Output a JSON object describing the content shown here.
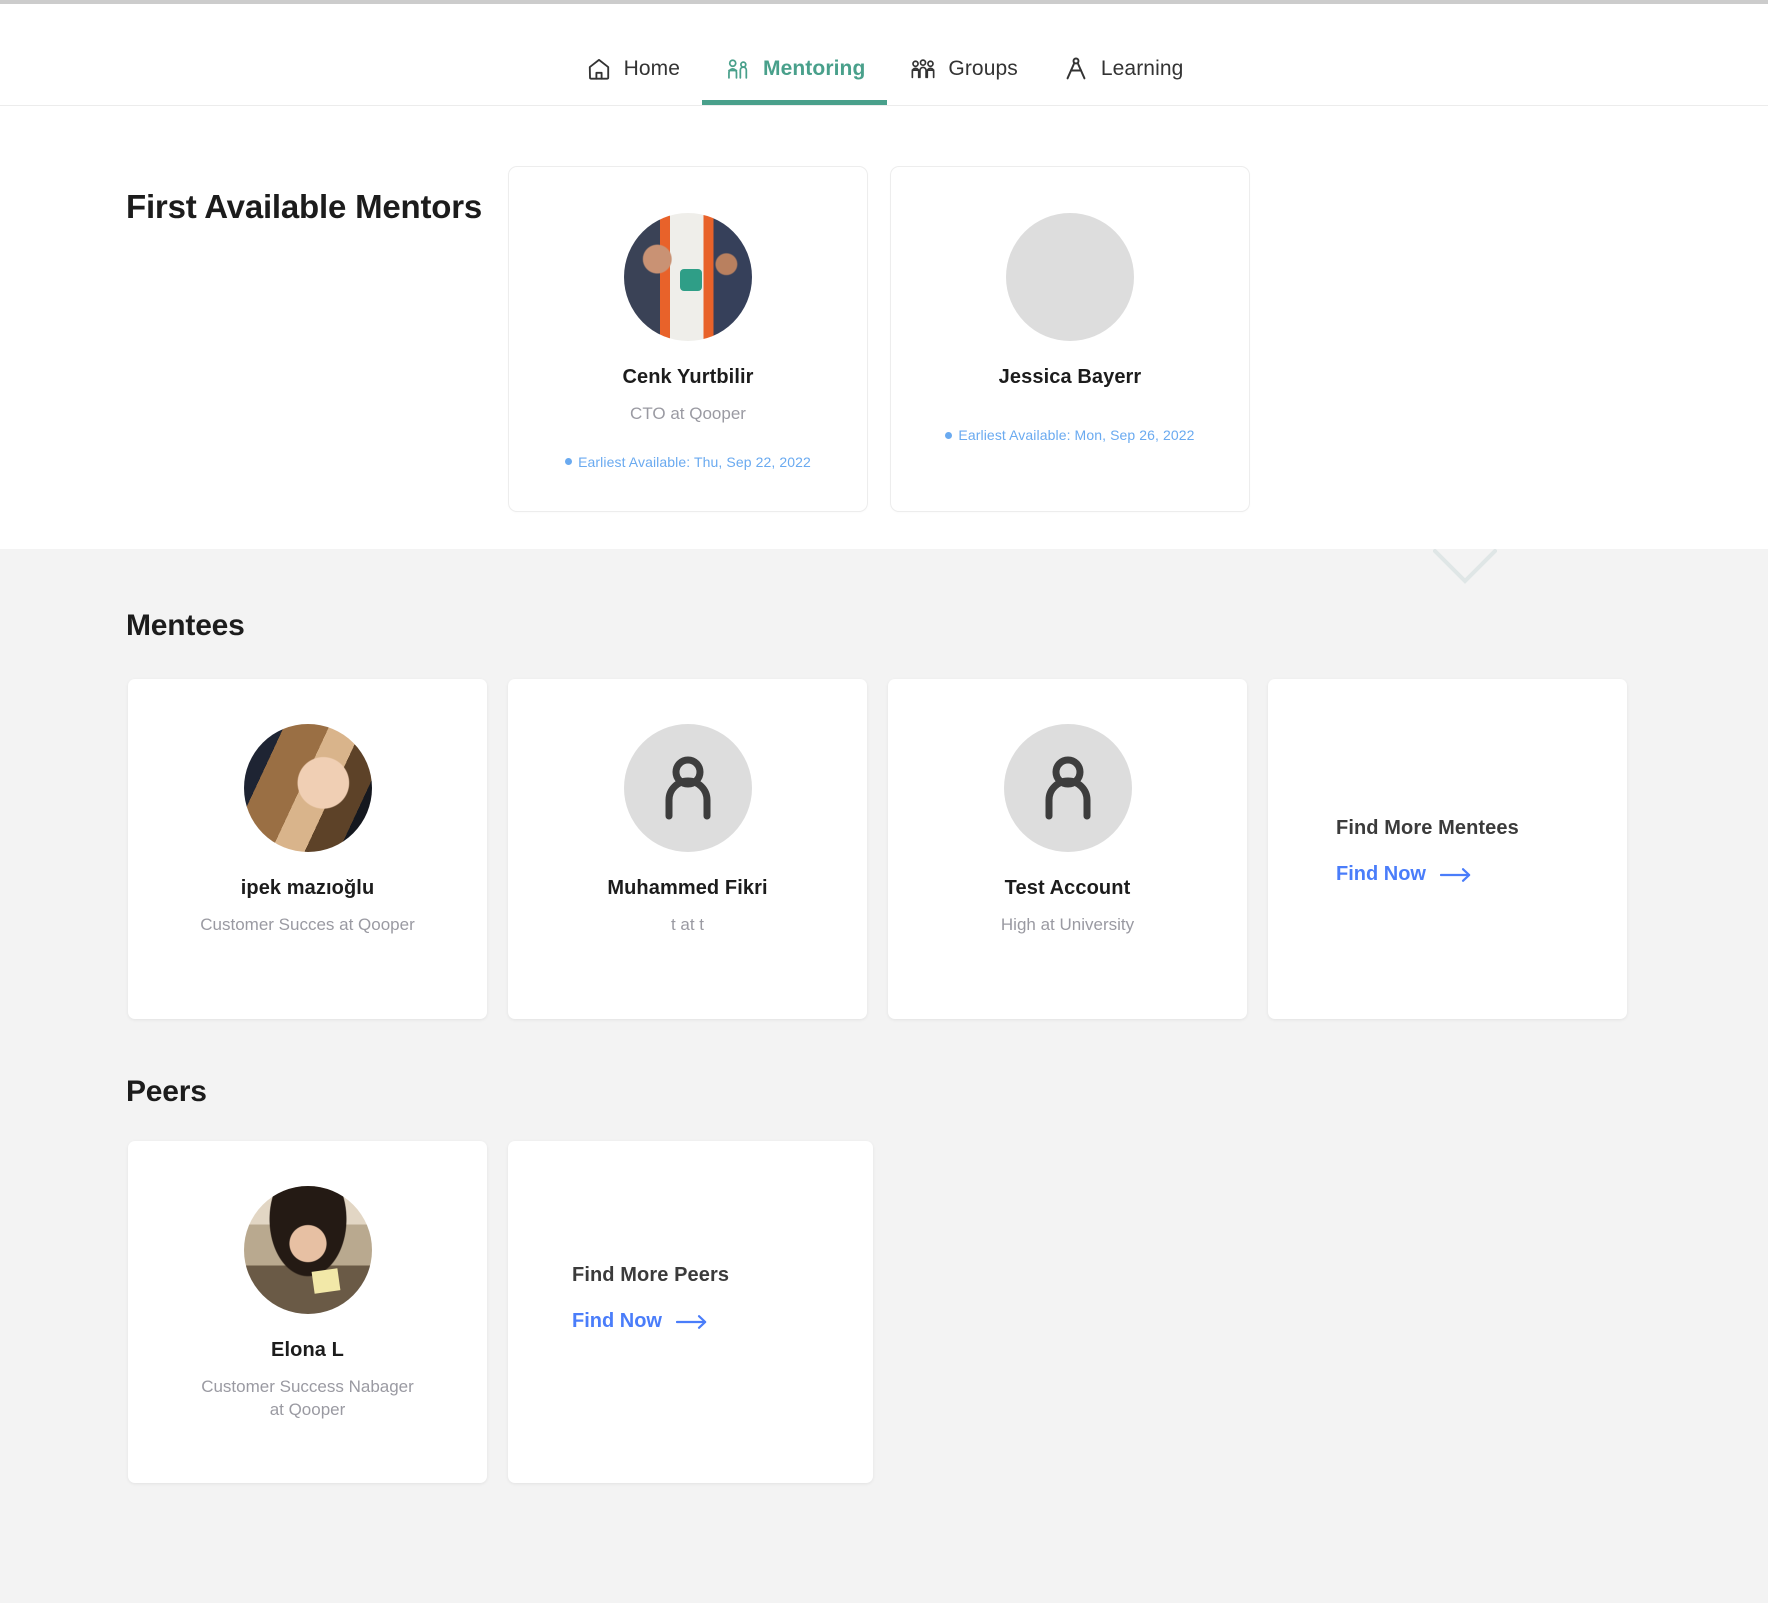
{
  "nav": {
    "items": [
      {
        "label": "Home",
        "icon": "home-icon",
        "active": false
      },
      {
        "label": "Mentoring",
        "icon": "mentoring-icon",
        "active": true
      },
      {
        "label": "Groups",
        "icon": "groups-icon",
        "active": false
      },
      {
        "label": "Learning",
        "icon": "learning-compass-icon",
        "active": false
      }
    ],
    "active_color": "#49a08b"
  },
  "mentors": {
    "heading": "First Available Mentors",
    "cards": [
      {
        "name": "Cenk Yurtbilir",
        "title": "CTO at Qooper",
        "availability": "Earliest Available: Thu, Sep 22, 2022",
        "avatar": "photo-cenk"
      },
      {
        "name": "Jessica Bayerr",
        "title": "",
        "availability": "Earliest Available: Mon, Sep 26, 2022",
        "avatar": "photo-jessica"
      }
    ],
    "availability_color": "#6aaaf0"
  },
  "mentees": {
    "heading": "Mentees",
    "cards": [
      {
        "name": "ipek mazıoğlu",
        "title": "Customer Succes at Qooper",
        "avatar": "photo-ipek"
      },
      {
        "name": "Muhammed Fikri",
        "title": "t at t",
        "avatar": "placeholder-person-icon"
      },
      {
        "name": "Test Account",
        "title": "High at University",
        "avatar": "placeholder-person-icon"
      }
    ],
    "find_more": {
      "heading": "Find More Mentees",
      "action_label": "Find Now",
      "action_icon": "arrow-right-icon",
      "action_color": "#4a7dfa"
    }
  },
  "peers": {
    "heading": "Peers",
    "cards": [
      {
        "name": "Elona L",
        "title": "Customer Success Nabager at Qooper",
        "avatar": "photo-elona"
      }
    ],
    "find_more": {
      "heading": "Find More Peers",
      "action_label": "Find Now",
      "action_icon": "arrow-right-icon",
      "action_color": "#4a7dfa"
    }
  },
  "theme": {
    "page_background": "#ffffff",
    "section_background": "#f3f3f3",
    "card_background": "#ffffff",
    "text_primary": "#1c1c1c",
    "text_secondary": "#9a9aa2"
  }
}
